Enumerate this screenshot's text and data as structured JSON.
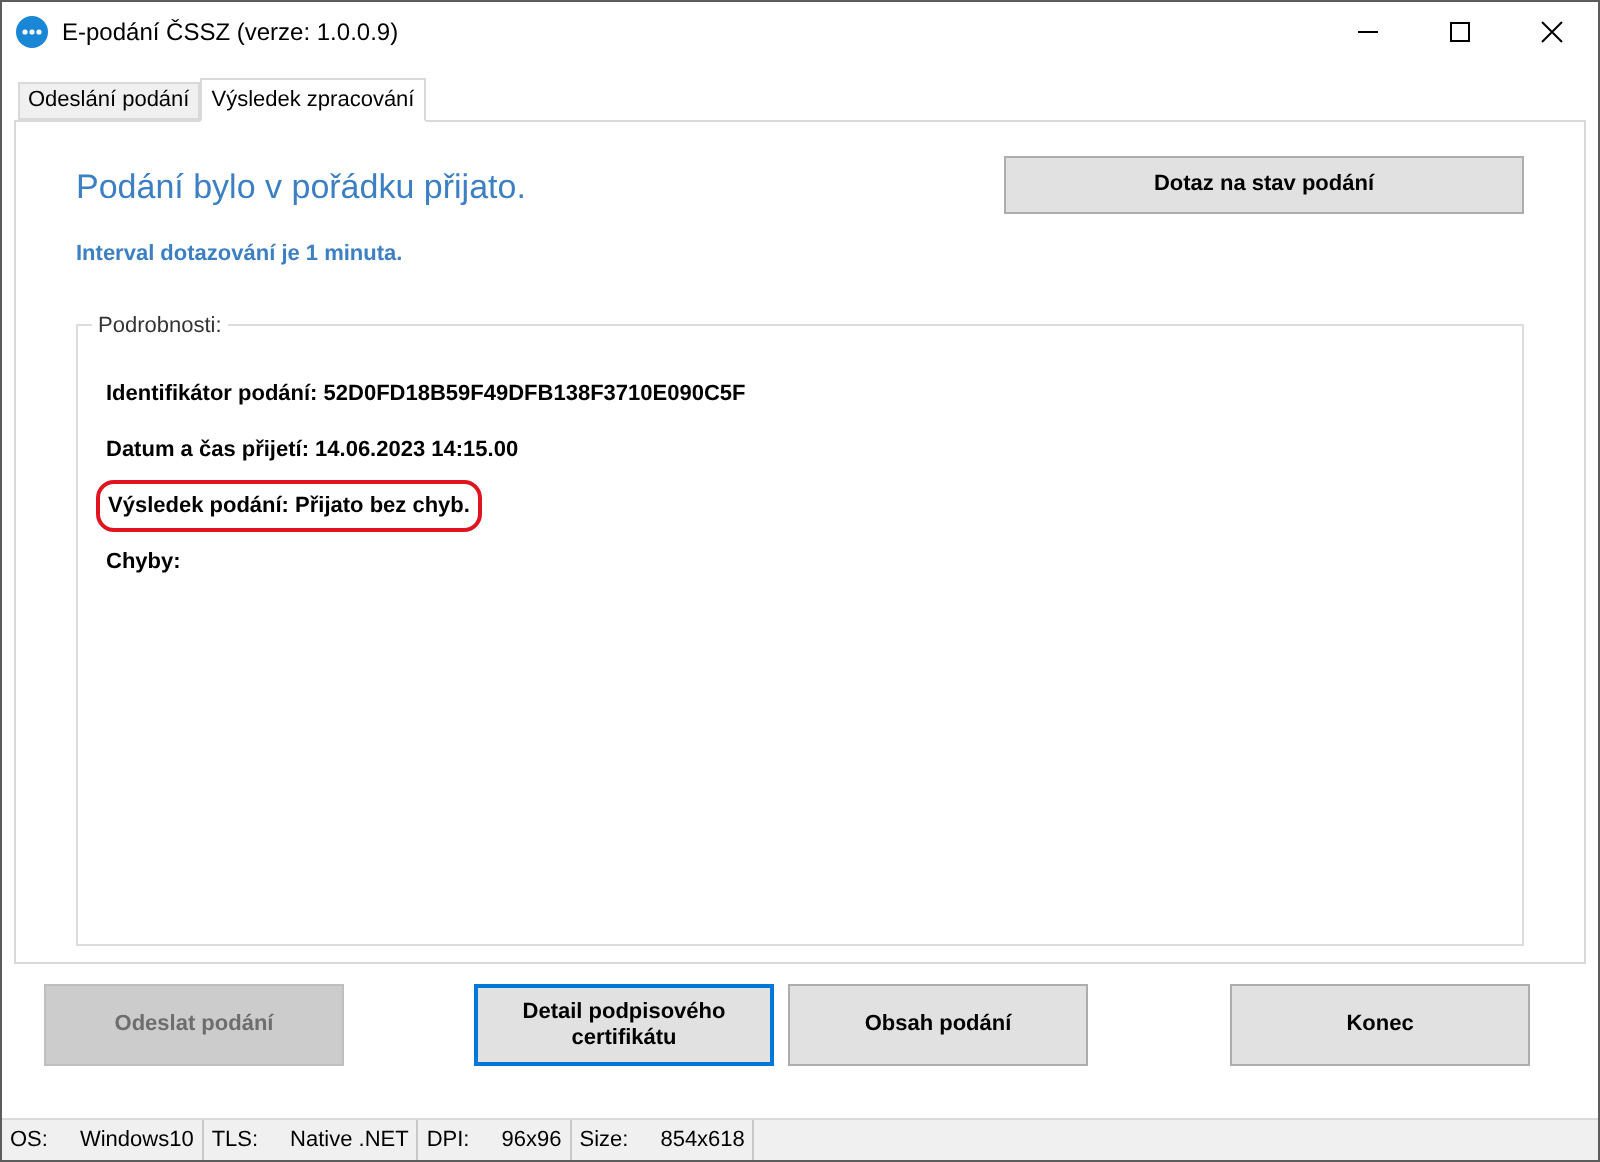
{
  "window": {
    "title": "E-podání ČSSZ (verze: 1.0.0.9)"
  },
  "tabs": [
    {
      "label": "Odeslání podání",
      "selected": false
    },
    {
      "label": "Výsledek zpracování",
      "selected": true
    }
  ],
  "result": {
    "heading": "Podání bylo v pořádku přijato.",
    "query_button": "Dotaz na stav podání",
    "interval": "Interval dotazování je 1 minuta."
  },
  "details": {
    "title": "Podrobnosti:",
    "lines": [
      {
        "text": "Identifikátor podání: 52D0FD18B59F49DFB138F3710E090C5F",
        "highlighted": false
      },
      {
        "text": "Datum a čas přijetí: 14.06.2023 14:15.00",
        "highlighted": false
      },
      {
        "text": "Výsledek podání: Přijato bez chyb.",
        "highlighted": true
      },
      {
        "text": "Chyby:",
        "highlighted": false
      }
    ]
  },
  "buttons": [
    {
      "label": "Odeslat podání",
      "disabled": true,
      "focused": false
    },
    {
      "label": "Detail podpisového certifikátu",
      "disabled": false,
      "focused": true
    },
    {
      "label": "Obsah podání",
      "disabled": false,
      "focused": false
    },
    {
      "label": "Konec",
      "disabled": false,
      "focused": false
    }
  ],
  "status_bar": [
    {
      "label": "OS:",
      "value": "Windows10"
    },
    {
      "label": "TLS:",
      "value": "Native .NET"
    },
    {
      "label": "DPI:",
      "value": "96x96"
    },
    {
      "label": "Size:",
      "value": "854x618"
    }
  ]
}
